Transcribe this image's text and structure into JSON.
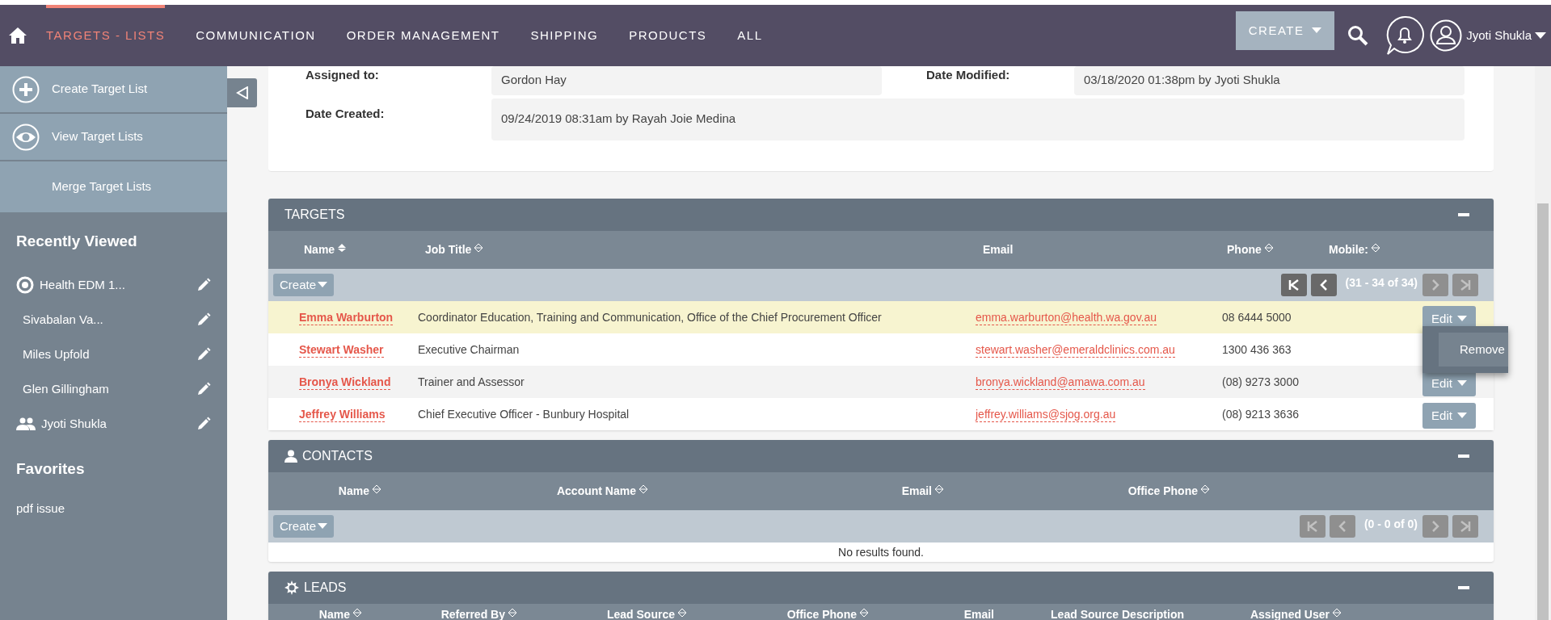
{
  "nav": {
    "tabs": [
      {
        "label": "TARGETS - LISTS",
        "selected": true
      },
      {
        "label": "COMMUNICATION",
        "selected": false
      },
      {
        "label": "ORDER MANAGEMENT",
        "selected": false
      },
      {
        "label": "SHIPPING",
        "selected": false
      },
      {
        "label": "PRODUCTS",
        "selected": false
      },
      {
        "label": "ALL",
        "selected": false
      }
    ],
    "create_button": "CREATE",
    "user_name": "Jyoti Shukla"
  },
  "sidebar": {
    "actions": [
      {
        "label": "Create Target List",
        "kind": "plus"
      },
      {
        "label": "View Target Lists",
        "kind": "eye"
      },
      {
        "label": "Merge Target Lists",
        "kind": "none"
      }
    ],
    "recently_viewed": {
      "title": "Recently Viewed",
      "items": [
        {
          "label": "Health EDM 1...",
          "kind": "target"
        },
        {
          "label": "Sivabalan Va...",
          "kind": "none"
        },
        {
          "label": "Miles Upfold",
          "kind": "none"
        },
        {
          "label": "Glen Gillingham",
          "kind": "none"
        },
        {
          "label": "Jyoti Shukla",
          "kind": "people"
        }
      ]
    },
    "favorites": {
      "title": "Favorites",
      "items": [
        "pdf issue"
      ]
    }
  },
  "details": {
    "rows": [
      [
        {
          "label": "Assigned to:",
          "value": "Gordon Hay"
        },
        {
          "label": "Date Modified:",
          "value": "03/18/2020 01:38pm by Jyoti Shukla"
        }
      ],
      [
        {
          "label": "Date Created:",
          "value": "09/24/2019 08:31am by Rayah Joie Medina"
        }
      ]
    ]
  },
  "subpanels": [
    {
      "title": "TARGETS",
      "kind": "plain",
      "columns": [
        {
          "label": "Name",
          "kind": "active"
        },
        {
          "label": "Job Title",
          "kind": "sortable"
        },
        {
          "label": "Email",
          "kind": "plain"
        },
        {
          "label": "Phone",
          "kind": "sortable"
        },
        {
          "label": "Mobile:",
          "kind": "sortable"
        }
      ],
      "create_button": "Create",
      "pagination": "(31 - 34 of 34)",
      "back_enabled": true,
      "forward_enabled": false,
      "rows": [
        {
          "name": "Emma Warburton",
          "job_title": "Coordinator Education, Training and Communication, Office of the Chief Procurement Officer",
          "email": "emma.warburton@health.wa.gov.au",
          "phone": "08 6444 5000",
          "edit_button": "Edit",
          "highlighted": true,
          "menu": [
            "Remove"
          ]
        },
        {
          "name": "Stewart Washer",
          "job_title": "Executive Chairman",
          "email": "stewart.washer@emeraldclinics.com.au",
          "phone": "1300 436 363",
          "highlighted": false
        },
        {
          "name": "Bronya Wickland",
          "job_title": "Trainer and Assessor",
          "email": "bronya.wickland@amawa.com.au",
          "phone": "(08) 9273 3000",
          "edit_button": "Edit",
          "highlighted": false
        },
        {
          "name": "Jeffrey Williams",
          "job_title": "Chief Executive Officer - Bunbury Hospital",
          "email": "jeffrey.williams@sjog.org.au",
          "phone": "(08) 9213 3636",
          "edit_button": "Edit",
          "highlighted": false
        }
      ]
    },
    {
      "title": "CONTACTS",
      "kind": "person",
      "columns": [
        {
          "label": "Name",
          "kind": "sortable"
        },
        {
          "label": "Account Name",
          "kind": "sortable"
        },
        {
          "label": "Email",
          "kind": "sortable"
        },
        {
          "label": "Office Phone",
          "kind": "sortable"
        }
      ],
      "create_button": "Create",
      "pagination": "(0 - 0 of 0)",
      "back_enabled": false,
      "forward_enabled": false,
      "empty_message": "No results found."
    },
    {
      "title": "LEADS",
      "kind": "gear",
      "columns": [
        {
          "label": "Name",
          "kind": "sortable"
        },
        {
          "label": "Referred By",
          "kind": "sortable"
        },
        {
          "label": "Lead Source",
          "kind": "sortable"
        },
        {
          "label": "Office Phone",
          "kind": "sortable"
        },
        {
          "label": "Email",
          "kind": "plain"
        },
        {
          "label": "Lead Source Description",
          "kind": "plain"
        },
        {
          "label": "Assigned User",
          "kind": "sortable"
        }
      ]
    }
  ]
}
